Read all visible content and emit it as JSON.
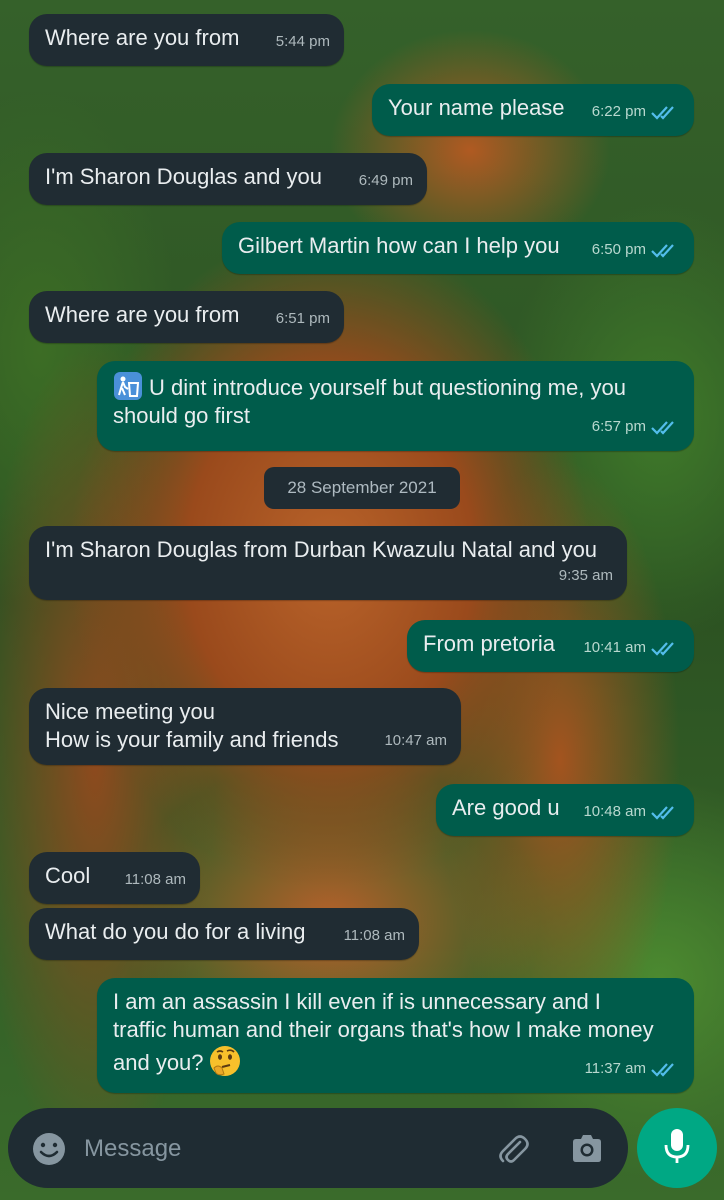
{
  "messages": [
    {
      "text": "Where are you from",
      "time": "5:44 pm"
    },
    {
      "text": "Your name please",
      "time": "6:22 pm"
    },
    {
      "text": "I'm Sharon Douglas and you",
      "time": "6:49 pm"
    },
    {
      "text": "Gilbert Martin how can I help you",
      "time": "6:50 pm"
    },
    {
      "text": "Where are you from",
      "time": "6:51 pm"
    },
    {
      "text": "U dint introduce yourself but questioning me, you\nshould go first",
      "time": "6:57 pm",
      "icon": "trash-person-icon"
    },
    {
      "text": "I'm Sharon Douglas from Durban Kwazulu Natal and you",
      "time": "9:35 am"
    },
    {
      "text": "From pretoria",
      "time": "10:41 am"
    },
    {
      "text": "Nice meeting you\nHow is your family and friends",
      "time": "10:47 am"
    },
    {
      "text": "Are good u",
      "time": "10:48 am"
    },
    {
      "text": "Cool",
      "time": "11:08 am"
    },
    {
      "text": "What do you do for a living",
      "time": "11:08 am"
    },
    {
      "text": "I am an assassin I kill even if is unnecessary and I\ntraffic human and their organs that's how I make money\nand you?",
      "time": "11:37 am",
      "emoji": "thinking-face"
    }
  ],
  "date_separator": "28 September 2021",
  "composer": {
    "placeholder": "Message",
    "icons": [
      "emoji-icon",
      "attach-icon",
      "camera-icon"
    ]
  },
  "mic_icon": "mic-icon",
  "colors": {
    "incoming_bubble": "#202c33",
    "outgoing_bubble": "#005c4b",
    "read_ticks": "#53bdeb",
    "send_button": "#00a884"
  }
}
